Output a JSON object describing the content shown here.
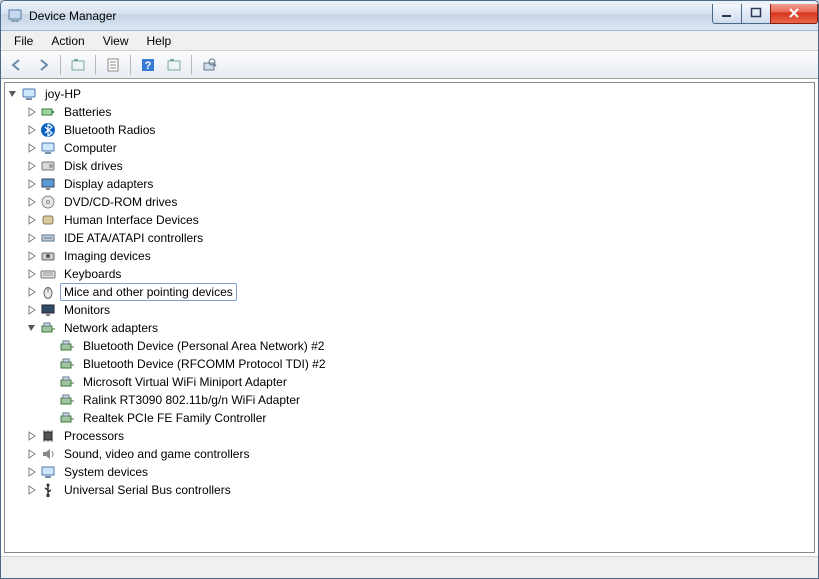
{
  "window_title": "Device Manager",
  "menu": {
    "file": "File",
    "action": "Action",
    "view": "View",
    "help": "Help"
  },
  "tree": {
    "root": {
      "label": "joy-HP",
      "expanded": true,
      "icon": "computer",
      "children": [
        {
          "label": "Batteries",
          "icon": "battery",
          "expanded": false,
          "hasChildren": true
        },
        {
          "label": "Bluetooth Radios",
          "icon": "bluetooth",
          "expanded": false,
          "hasChildren": true
        },
        {
          "label": "Computer",
          "icon": "computer",
          "expanded": false,
          "hasChildren": true
        },
        {
          "label": "Disk drives",
          "icon": "disk",
          "expanded": false,
          "hasChildren": true
        },
        {
          "label": "Display adapters",
          "icon": "display",
          "expanded": false,
          "hasChildren": true
        },
        {
          "label": "DVD/CD-ROM drives",
          "icon": "dvd",
          "expanded": false,
          "hasChildren": true
        },
        {
          "label": "Human Interface Devices",
          "icon": "hid",
          "expanded": false,
          "hasChildren": true
        },
        {
          "label": "IDE ATA/ATAPI controllers",
          "icon": "ide",
          "expanded": false,
          "hasChildren": true
        },
        {
          "label": "Imaging devices",
          "icon": "imaging",
          "expanded": false,
          "hasChildren": true
        },
        {
          "label": "Keyboards",
          "icon": "keyboard",
          "expanded": false,
          "hasChildren": true
        },
        {
          "label": "Mice and other pointing devices",
          "icon": "mouse",
          "expanded": false,
          "hasChildren": true,
          "selected": true
        },
        {
          "label": "Monitors",
          "icon": "monitor",
          "expanded": false,
          "hasChildren": true
        },
        {
          "label": "Network adapters",
          "icon": "network",
          "expanded": true,
          "hasChildren": true,
          "children": [
            {
              "label": "Bluetooth Device (Personal Area Network) #2",
              "icon": "netcard"
            },
            {
              "label": "Bluetooth Device (RFCOMM Protocol TDI) #2",
              "icon": "netcard"
            },
            {
              "label": "Microsoft Virtual WiFi Miniport Adapter",
              "icon": "netcard"
            },
            {
              "label": "Ralink RT3090 802.11b/g/n WiFi Adapter",
              "icon": "netcard"
            },
            {
              "label": "Realtek PCIe FE Family Controller",
              "icon": "netcard"
            }
          ]
        },
        {
          "label": "Processors",
          "icon": "cpu",
          "expanded": false,
          "hasChildren": true
        },
        {
          "label": "Sound, video and game controllers",
          "icon": "sound",
          "expanded": false,
          "hasChildren": true
        },
        {
          "label": "System devices",
          "icon": "system",
          "expanded": false,
          "hasChildren": true
        },
        {
          "label": "Universal Serial Bus controllers",
          "icon": "usb",
          "expanded": false,
          "hasChildren": true
        }
      ]
    }
  }
}
